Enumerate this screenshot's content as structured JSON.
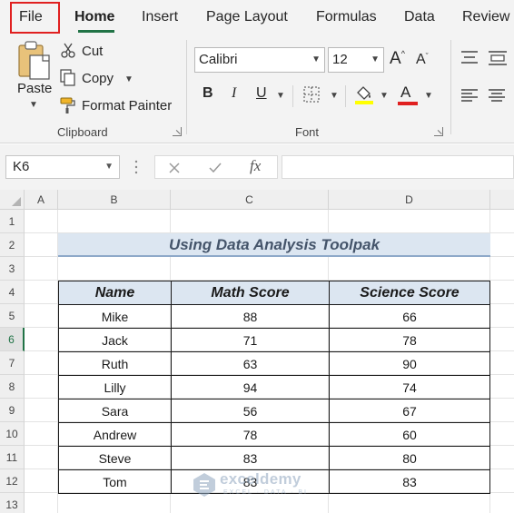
{
  "tabs": [
    "File",
    "Home",
    "Insert",
    "Page Layout",
    "Formulas",
    "Data",
    "Review"
  ],
  "clipboard": {
    "paste_label": "Paste",
    "cut_label": "Cut",
    "copy_label": "Copy",
    "format_painter_label": "Format Painter",
    "group_label": "Clipboard"
  },
  "font": {
    "font_name": "Calibri",
    "font_size": "12",
    "group_label": "Font",
    "highlight_color": "#ffff00",
    "font_color": "#e02020"
  },
  "formula_bar": {
    "name_box": "K6",
    "fx_label": "fx",
    "formula": ""
  },
  "sheet": {
    "columns": [
      "A",
      "B",
      "C",
      "D"
    ],
    "rows": [
      "1",
      "2",
      "3",
      "4",
      "5",
      "6",
      "7",
      "8",
      "9",
      "10",
      "11",
      "12",
      "13"
    ],
    "selected_row": "6",
    "title": "Using Data Analysis Toolpak",
    "headers": [
      "Name",
      "Math Score",
      "Science Score"
    ],
    "data": [
      [
        "Mike",
        "88",
        "66"
      ],
      [
        "Jack",
        "71",
        "78"
      ],
      [
        "Ruth",
        "63",
        "90"
      ],
      [
        "Lilly",
        "94",
        "74"
      ],
      [
        "Sara",
        "56",
        "67"
      ],
      [
        "Andrew",
        "78",
        "60"
      ],
      [
        "Steve",
        "83",
        "80"
      ],
      [
        "Tom",
        "83",
        "83"
      ]
    ]
  },
  "watermark": {
    "name": "exceldemy",
    "tagline": "EXCEL · DATA · BI"
  },
  "colors": {
    "accent_green": "#217346",
    "title_fill": "#dce6f1",
    "title_text": "#44546a",
    "file_highlight": "#e02020"
  }
}
